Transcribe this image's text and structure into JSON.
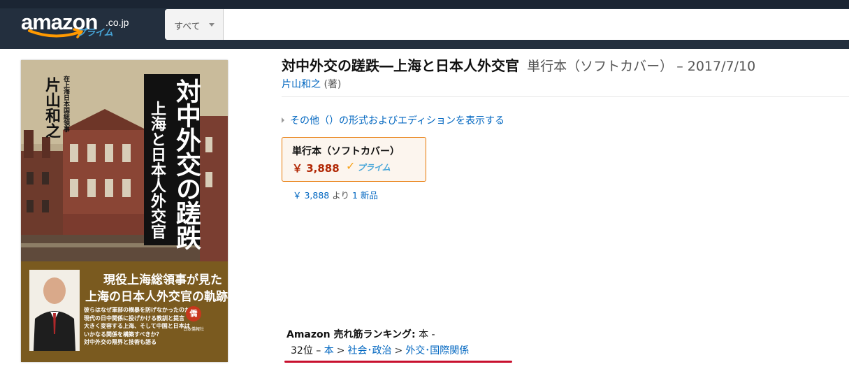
{
  "header": {
    "logo_word": "amazon",
    "logo_tld": ".co.jp",
    "logo_prime": "プライム",
    "search_category": "すべて",
    "search_value": "",
    "colors": {
      "bar": "#232f3e",
      "smile": "#ff9900",
      "prime_blue": "#47a6d9"
    }
  },
  "cover": {
    "title": "対中外交の蹉跌",
    "subtitle": "上海と日本人外交官",
    "author": "片山和之",
    "author_suffix": "著",
    "author_role": "在上海日本国総領事",
    "lead_line1": "現役上海総領事が見た",
    "lead_line2": "上海の日本人外交官の軌跡",
    "blurb": [
      "彼らはなぜ軍部の横暴を防げなかったのか",
      "現代の日中関係に投げかける教訓と提言",
      "大きく変容する上海、そして中国と日本は",
      "いかなる関係を構築すべきか？",
      "対中外交の限界と技術も語る"
    ],
    "publisher_mark": "僑",
    "publisher": "日本僑報社"
  },
  "product": {
    "title": "対中外交の蹉跌―上海と日本人外交官",
    "format": "単行本（ソフトカバー）",
    "date": " – 2017/7/10",
    "author_name": "片山和之",
    "author_role": " (著)",
    "editions_link": "その他（）の形式およびエディションを表示する",
    "format_box": {
      "label": "単行本（ソフトカバー）",
      "price": "￥ 3,888",
      "prime_check": "✓",
      "prime_word": "プライム"
    },
    "new_offer": {
      "price": "￥ 3,888",
      "from": " より ",
      "count_label": "1 新品"
    },
    "accent_color": "#e77600",
    "price_color": "#b12704"
  },
  "ranking": {
    "label_prefix": "Amazon 売れ筋ランキング:",
    "label_suffix": " 本 -",
    "rank": "32位",
    "dash": " – ",
    "path": [
      "本",
      "社会･政治",
      "外交･国際関係"
    ],
    "separator": ">",
    "underline_color": "#c8102e"
  }
}
